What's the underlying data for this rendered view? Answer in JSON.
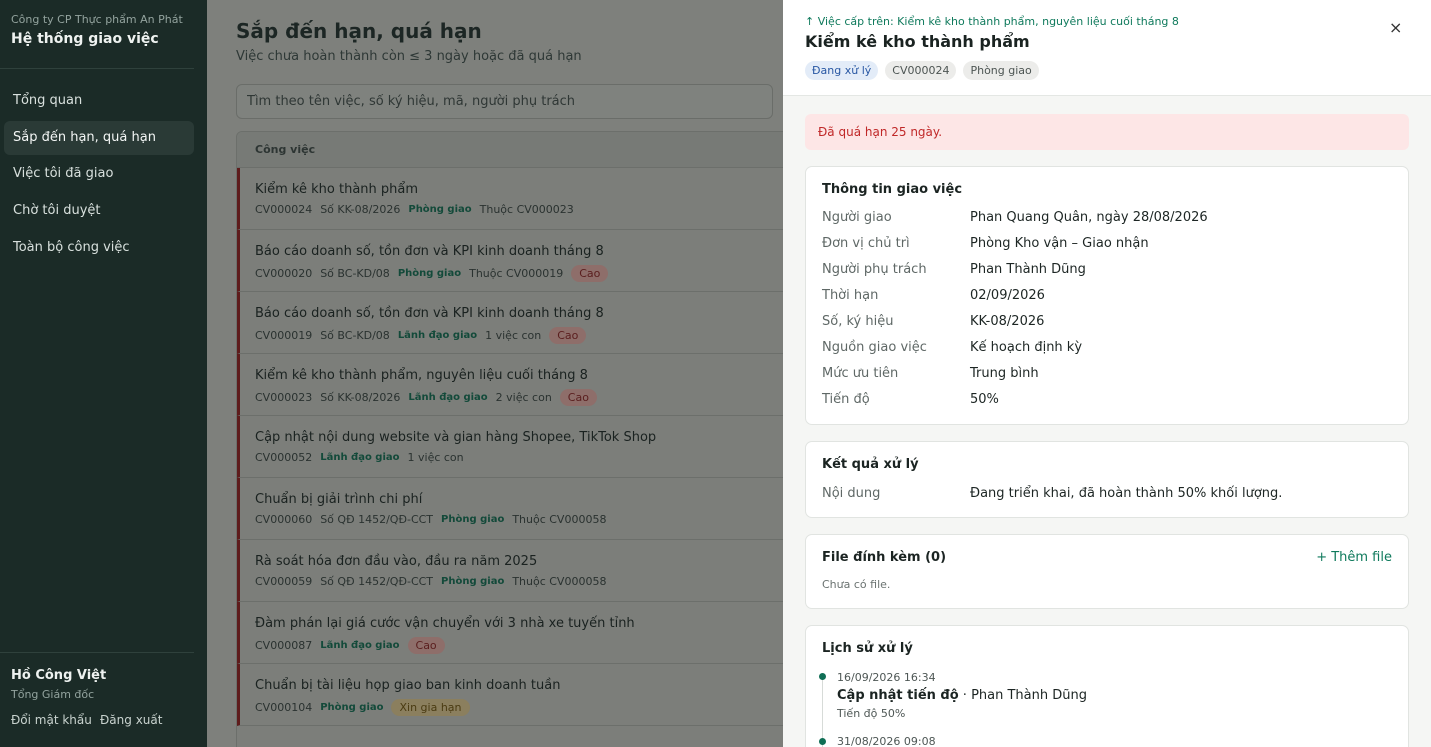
{
  "sidebar": {
    "company": "Công ty CP Thực phẩm An Phát",
    "system_title": "Hệ thống giao việc",
    "items": [
      {
        "label": "Tổng quan"
      },
      {
        "label": "Sắp đến hạn, quá hạn"
      },
      {
        "label": "Việc tôi đã giao"
      },
      {
        "label": "Chờ tôi duyệt"
      },
      {
        "label": "Toàn bộ công việc"
      }
    ],
    "active_index": 1,
    "user_name": "Hồ Công Việt",
    "user_role": "Tổng Giám đốc",
    "change_password": "Đổi mật khẩu",
    "logout": "Đăng xuất"
  },
  "main": {
    "title": "Sắp đến hạn, quá hạn",
    "subtitle": "Việc chưa hoàn thành còn ≤ 3 ngày hoặc đã quá hạn",
    "search_placeholder": "Tìm theo tên việc, số ký hiệu, mã, người phụ trách",
    "column_header": "Công việc",
    "rows": [
      {
        "title": "Kiểm kê kho thành phẩm",
        "code": "CV000024",
        "number": "Số KK-08/2026",
        "source": "Phòng giao",
        "extra": "Thuộc CV000023",
        "priority": "",
        "tag": ""
      },
      {
        "title": "Báo cáo doanh số, tồn đơn và KPI kinh doanh tháng 8",
        "code": "CV000020",
        "number": "Số BC-KD/08",
        "source": "Phòng giao",
        "extra": "Thuộc CV000019",
        "priority": "Cao",
        "tag": ""
      },
      {
        "title": "Báo cáo doanh số, tồn đơn và KPI kinh doanh tháng 8",
        "code": "CV000019",
        "number": "Số BC-KD/08",
        "source": "Lãnh đạo giao",
        "extra": "1 việc con",
        "priority": "Cao",
        "tag": ""
      },
      {
        "title": "Kiểm kê kho thành phẩm, nguyên liệu cuối tháng 8",
        "code": "CV000023",
        "number": "Số KK-08/2026",
        "source": "Lãnh đạo giao",
        "extra": "2 việc con",
        "priority": "Cao",
        "tag": ""
      },
      {
        "title": "Cập nhật nội dung website và gian hàng Shopee, TikTok Shop",
        "code": "CV000052",
        "number": "",
        "source": "Lãnh đạo giao",
        "extra": "1 việc con",
        "priority": "",
        "tag": ""
      },
      {
        "title": "Chuẩn bị giải trình chi phí",
        "code": "CV000060",
        "number": "Số QĐ 1452/QĐ-CCT",
        "source": "Phòng giao",
        "extra": "Thuộc CV000058",
        "priority": "",
        "tag": ""
      },
      {
        "title": "Rà soát hóa đơn đầu vào, đầu ra năm 2025",
        "code": "CV000059",
        "number": "Số QĐ 1452/QĐ-CCT",
        "source": "Phòng giao",
        "extra": "Thuộc CV000058",
        "priority": "",
        "tag": ""
      },
      {
        "title": "Đàm phán lại giá cước vận chuyển với 3 nhà xe tuyến tỉnh",
        "code": "CV000087",
        "number": "",
        "source": "Lãnh đạo giao",
        "extra": "",
        "priority": "Cao",
        "tag": ""
      },
      {
        "title": "Chuẩn bị tài liệu họp giao ban kinh doanh tuần",
        "code": "CV000104",
        "number": "",
        "source": "Phòng giao",
        "extra": "",
        "priority": "",
        "tag": "Xin gia hạn"
      }
    ]
  },
  "drawer": {
    "parent_link": "↑ Việc cấp trên: Kiểm kê kho thành phẩm, nguyên liệu cuối tháng 8",
    "title": "Kiểm kê kho thành phẩm",
    "badges": [
      "Đang xử lý",
      "CV000024",
      "Phòng giao"
    ],
    "close": "×",
    "alert": "Đã quá hạn 25 ngày.",
    "info_title": "Thông tin giao việc",
    "info": [
      {
        "k": "Người giao",
        "v": "Phan Quang Quân, ngày 28/08/2026"
      },
      {
        "k": "Đơn vị chủ trì",
        "v": "Phòng Kho vận – Giao nhận"
      },
      {
        "k": "Người phụ trách",
        "v": "Phan Thành Dũng"
      },
      {
        "k": "Thời hạn",
        "v": "02/09/2026"
      },
      {
        "k": "Số, ký hiệu",
        "v": "KK-08/2026"
      },
      {
        "k": "Nguồn giao việc",
        "v": "Kế hoạch định kỳ"
      },
      {
        "k": "Mức ưu tiên",
        "v": "Trung bình"
      },
      {
        "k": "Tiến độ",
        "v": "50%"
      }
    ],
    "result_title": "Kết quả xử lý",
    "result_key": "Nội dung",
    "result_value": "Đang triển khai, đã hoàn thành 50% khối lượng.",
    "files_title": "File đính kèm (0)",
    "add_file": "+ Thêm file",
    "files_empty": "Chưa có file.",
    "history_title": "Lịch sử xử lý",
    "history": [
      {
        "time": "16/09/2026 16:34",
        "action": "Cập nhật tiến độ",
        "by": " · Phan Thành Dũng",
        "note": "Tiến độ 50%"
      },
      {
        "time": "31/08/2026 09:08",
        "action": "",
        "by": "",
        "note": ""
      }
    ]
  }
}
